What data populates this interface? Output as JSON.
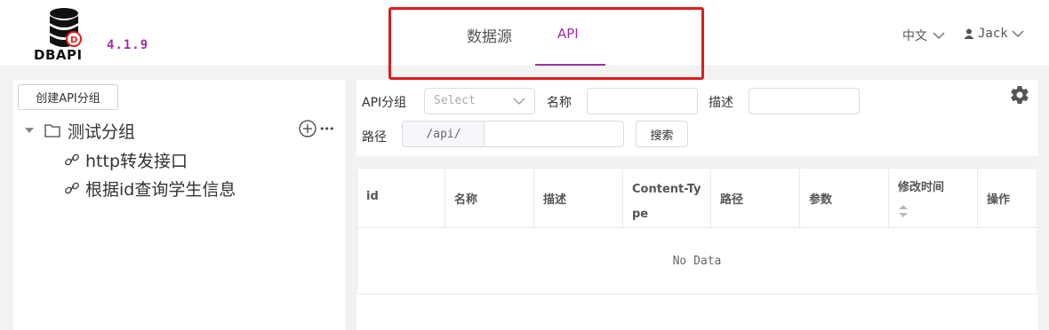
{
  "app": {
    "logo_text": "DBAPI",
    "version": "4.1.9"
  },
  "nav": {
    "tabs": [
      {
        "label": "数据源",
        "active": false
      },
      {
        "label": "API",
        "active": true
      }
    ],
    "accent_color": "#9b30a4",
    "highlight_color": "#e01b1b"
  },
  "header": {
    "language": "中文",
    "user": "Jack"
  },
  "sidebar": {
    "create_button": "创建API分组",
    "groups": [
      {
        "label": "测试分组",
        "items": [
          {
            "label": "http转发接口"
          },
          {
            "label": "根据id查询学生信息"
          }
        ]
      }
    ],
    "more_glyph": "•••"
  },
  "search": {
    "group_label": "API分组",
    "group_placeholder": "Select",
    "name_label": "名称",
    "name_value": "",
    "desc_label": "描述",
    "desc_value": "",
    "path_label": "路径",
    "path_prefix": "/api/",
    "path_value": "",
    "search_button": "搜索"
  },
  "table": {
    "columns": [
      {
        "label": "id"
      },
      {
        "label": "名称"
      },
      {
        "label": "描述"
      },
      {
        "label": "Content-Type"
      },
      {
        "label": "路径"
      },
      {
        "label": "参数"
      },
      {
        "label": "修改时间",
        "sortable": true
      },
      {
        "label": "操作"
      }
    ],
    "rows": [],
    "empty_text": "No Data"
  },
  "icons": [
    "database-logo-icon",
    "chevron-down-icon",
    "user-icon",
    "caret-down-icon",
    "folder-icon",
    "add-circle-icon",
    "more-icon",
    "link-icon",
    "gear-icon",
    "sort-icon"
  ]
}
